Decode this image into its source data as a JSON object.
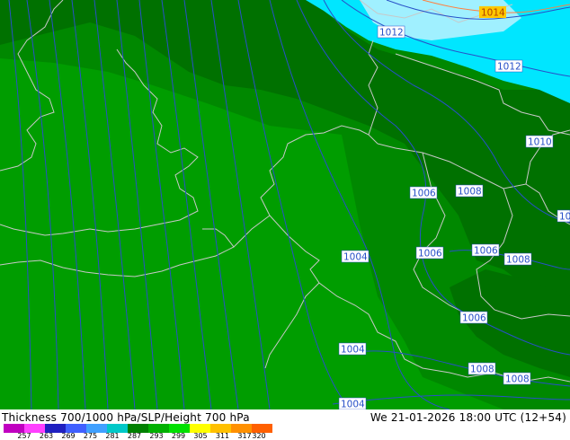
{
  "title": "Thickness 700/1000 hPa/SLP/Height 700 hPa",
  "datetime": "We 21-01-2026 18:00 UTC (12+54)",
  "isobar_labels": [
    {
      "text": "1014",
      "style": "orange"
    },
    {
      "text": "1012",
      "style": "box"
    },
    {
      "text": "1012",
      "style": "box"
    },
    {
      "text": "1010",
      "style": "box"
    },
    {
      "text": "1006",
      "style": "box"
    },
    {
      "text": "1008",
      "style": "box"
    },
    {
      "text": "10",
      "style": "box"
    },
    {
      "text": "1004",
      "style": "box"
    },
    {
      "text": "1006",
      "style": "box"
    },
    {
      "text": "1006",
      "style": "box"
    },
    {
      "text": "1008",
      "style": "box"
    },
    {
      "text": "1006",
      "style": "box"
    },
    {
      "text": "1004",
      "style": "box"
    },
    {
      "text": "1008",
      "style": "box"
    },
    {
      "text": "1008",
      "style": "box"
    },
    {
      "text": "1004",
      "style": "box"
    }
  ],
  "legend": {
    "ticks": [
      "257",
      "263",
      "269",
      "275",
      "281",
      "287",
      "293",
      "299",
      "305",
      "311",
      "317",
      "320"
    ],
    "colors": [
      "#c000c0",
      "#ff40ff",
      "#2020c0",
      "#4060ff",
      "#40a0ff",
      "#00c8c8",
      "#008000",
      "#00b000",
      "#00e000",
      "#ffff00",
      "#ffc000",
      "#ff9000",
      "#ff6000"
    ]
  },
  "colors": {
    "fill_dark": "#007100",
    "fill_mid": "#008800",
    "fill_light": "#009d00",
    "fill_cyan": "#00e6ff",
    "contour": "#2850c8",
    "coast": "#c8c8c8"
  }
}
